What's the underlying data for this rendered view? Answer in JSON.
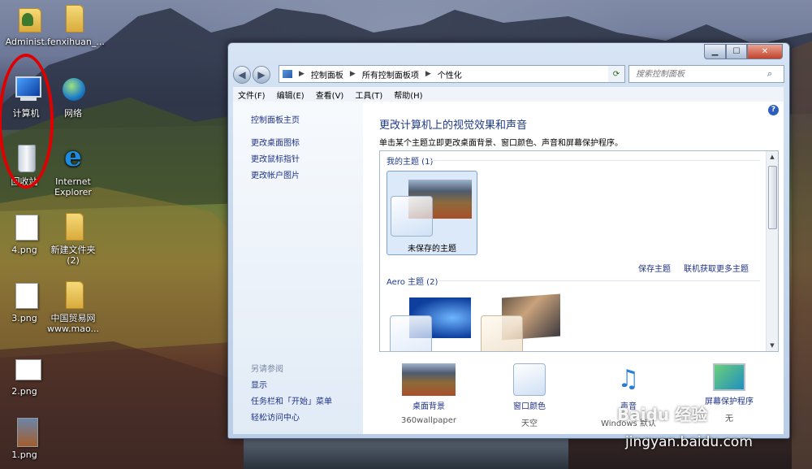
{
  "desktop": {
    "icons": [
      {
        "label": "Administ..."
      },
      {
        "label": "fenxihuan_..."
      },
      {
        "label": "计算机"
      },
      {
        "label": "网络"
      },
      {
        "label": "回收站"
      },
      {
        "label": "Internet Explorer"
      },
      {
        "label": "4.png"
      },
      {
        "label": "新建文件夹 (2)"
      },
      {
        "label": "3.png"
      },
      {
        "label": "中国贸易网 www.mao..."
      },
      {
        "label": "2.png"
      },
      {
        "label": "1.png"
      }
    ]
  },
  "window": {
    "address": {
      "segments": [
        "控制面板",
        "所有控制面板项",
        "个性化"
      ]
    },
    "search": {
      "placeholder": "搜索控制面板"
    },
    "menu": [
      "文件(F)",
      "编辑(E)",
      "查看(V)",
      "工具(T)",
      "帮助(H)"
    ],
    "left_pane": {
      "home": "控制面板主页",
      "links": [
        "更改桌面图标",
        "更改鼠标指针",
        "更改帐户图片"
      ],
      "see_also_title": "另请参阅",
      "see_also": [
        "显示",
        "任务栏和「开始」菜单",
        "轻松访问中心"
      ]
    },
    "main": {
      "title": "更改计算机上的视觉效果和声音",
      "description": "单击某个主题立即更改桌面背景、窗口颜色、声音和屏幕保护程序。",
      "my_themes_header": "我的主题 (1)",
      "unsaved_theme": "未保存的主题",
      "save_theme": "保存主题",
      "get_more_themes": "联机获取更多主题",
      "aero_header": "Aero 主题 (2)"
    },
    "bottom": [
      {
        "label": "桌面背景",
        "sub": "360wallpaper"
      },
      {
        "label": "窗口颜色",
        "sub": "天空"
      },
      {
        "label": "声音",
        "sub": "Windows 默认"
      },
      {
        "label": "屏幕保护程序",
        "sub": "无"
      }
    ]
  },
  "watermark": {
    "brand": "Baidu 经验",
    "url": "jingyan.baidu.com"
  }
}
